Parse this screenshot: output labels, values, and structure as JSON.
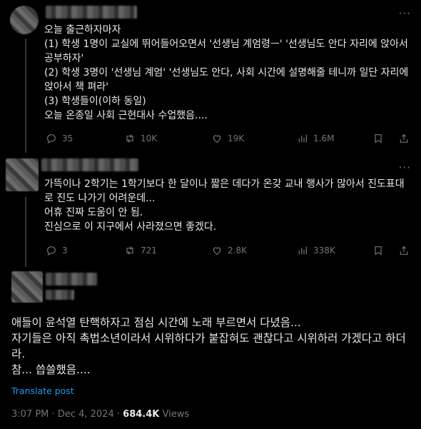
{
  "posts": [
    {
      "more_label": "···",
      "body": "오늘 출근하자마자\n(1) 학생 1명이 교실에 뛰어들어오면서 '선생님 계엄령ㅡ' '선생님도 안다 자리에 앉아서 공부하자'\n(2) 학생 3명이 '선생님 계엄' '선생님도 안다, 사회 시간에 설명해줄 테니까 일단 자리에 앉아서 책 펴라'\n(3) 학생들이(이하 동일)\n오늘 온종일 사회 근현대사 수업했음....",
      "stats": {
        "replies": "35",
        "reposts": "10K",
        "likes": "19K",
        "views": "1.6M"
      }
    },
    {
      "more_label": "···",
      "body": "가뜩이나 2학기는 1학기보다 한 달이나 짧은 데다가 온갖 교내 행사가 많아서 진도표대로 진도 나가기 어려운데...\n어휴 진짜 도움이 안 됨.\n진심으로 이 지구에서 사라졌으면 좋겠다.",
      "stats": {
        "replies": "3",
        "reposts": "721",
        "likes": "2.8K",
        "views": "338K"
      }
    }
  ],
  "main_post": {
    "body": "애들이 윤석열 탄핵하자고 점심 시간에 노래 부르면서 다녔음...\n자기들은 아직 촉법소년이라서 시위하다가 붙잡혀도 괜찮다고 시위하러 가겠다고 하더라.\n참... 씁쓸했음....",
    "translate_label": "Translate post",
    "time": "3:07 PM",
    "date": "Dec 4, 2024",
    "views_count": "684.4K",
    "views_label": "Views",
    "separator": "·"
  },
  "icons": [
    "reply-icon",
    "repost-icon",
    "like-icon",
    "views-icon",
    "bookmark-icon",
    "share-icon"
  ],
  "colors": {
    "background": "#000000",
    "text": "#e7e9ea",
    "muted": "#71767b",
    "link": "#1d9bf0"
  }
}
